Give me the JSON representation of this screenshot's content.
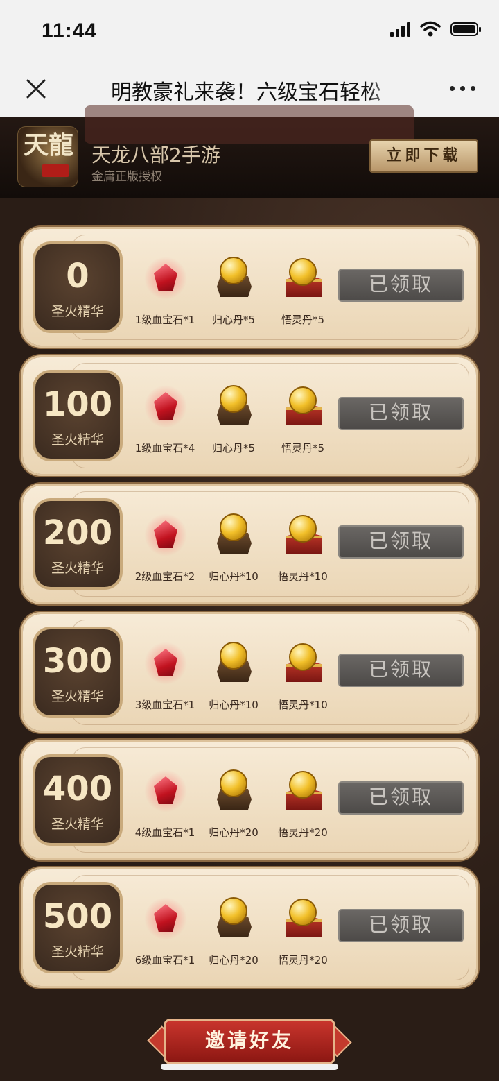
{
  "status_bar": {
    "time": "11:44"
  },
  "nav": {
    "title": "明教豪礼来袭！六级宝石轻松"
  },
  "banner": {
    "app_name": "天龙八部2手游",
    "app_subtitle": "金庸正版授权",
    "download_label": "立即下载",
    "logo_text": "天龍"
  },
  "tiers": [
    {
      "amount": "0",
      "label": "圣火精华",
      "items": [
        {
          "name": "1级血宝石*1",
          "icon": "gem-icon"
        },
        {
          "name": "归心丹*5",
          "icon": "token-icon"
        },
        {
          "name": "悟灵丹*5",
          "icon": "chest-icon"
        }
      ],
      "claim_label": "已领取"
    },
    {
      "amount": "100",
      "label": "圣火精华",
      "items": [
        {
          "name": "1级血宝石*4",
          "icon": "gem-icon"
        },
        {
          "name": "归心丹*5",
          "icon": "token-icon"
        },
        {
          "name": "悟灵丹*5",
          "icon": "chest-icon"
        }
      ],
      "claim_label": "已领取"
    },
    {
      "amount": "200",
      "label": "圣火精华",
      "items": [
        {
          "name": "2级血宝石*2",
          "icon": "gem-icon"
        },
        {
          "name": "归心丹*10",
          "icon": "token-icon"
        },
        {
          "name": "悟灵丹*10",
          "icon": "chest-icon"
        }
      ],
      "claim_label": "已领取"
    },
    {
      "amount": "300",
      "label": "圣火精华",
      "items": [
        {
          "name": "3级血宝石*1",
          "icon": "gem-icon"
        },
        {
          "name": "归心丹*10",
          "icon": "token-icon"
        },
        {
          "name": "悟灵丹*10",
          "icon": "chest-icon"
        }
      ],
      "claim_label": "已领取"
    },
    {
      "amount": "400",
      "label": "圣火精华",
      "items": [
        {
          "name": "4级血宝石*1",
          "icon": "gem-icon"
        },
        {
          "name": "归心丹*20",
          "icon": "token-icon"
        },
        {
          "name": "悟灵丹*20",
          "icon": "chest-icon"
        }
      ],
      "claim_label": "已领取"
    },
    {
      "amount": "500",
      "label": "圣火精华",
      "items": [
        {
          "name": "6级血宝石*1",
          "icon": "gem-icon"
        },
        {
          "name": "归心丹*20",
          "icon": "token-icon"
        },
        {
          "name": "悟灵丹*20",
          "icon": "chest-icon"
        }
      ],
      "claim_label": "已领取"
    }
  ],
  "invite": {
    "label": "邀请好友"
  }
}
